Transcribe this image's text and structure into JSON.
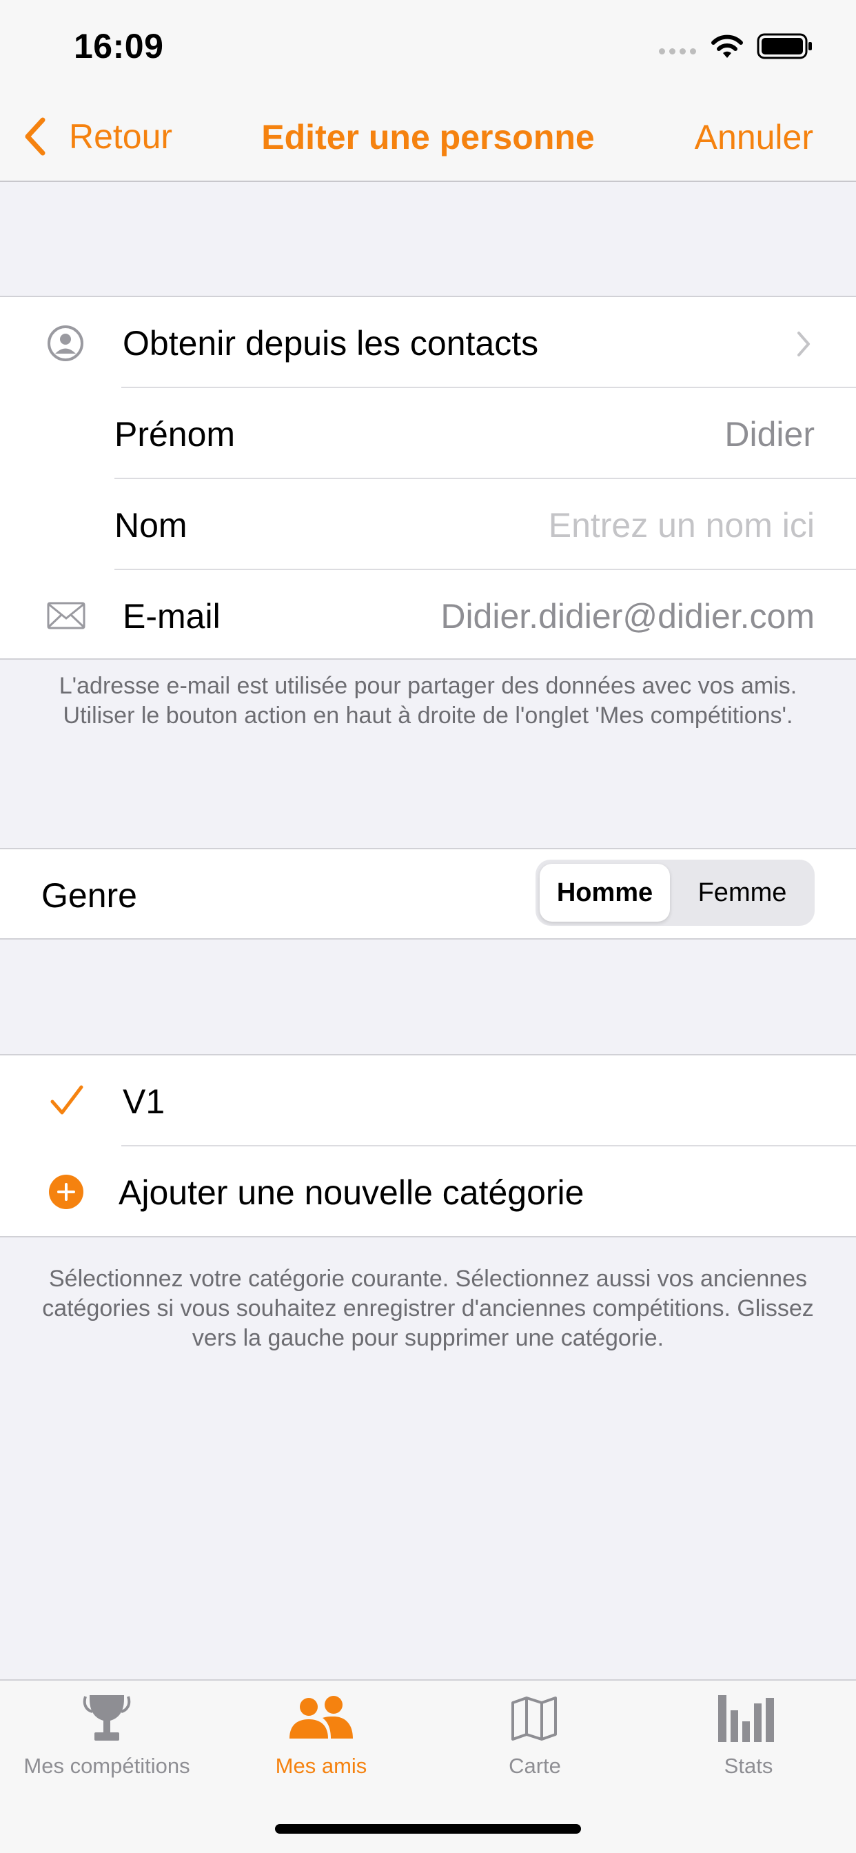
{
  "status_bar": {
    "time": "16:09"
  },
  "nav": {
    "back_label": "Retour",
    "title": "Editer une personne",
    "cancel_label": "Annuler"
  },
  "contact_section": {
    "import_label": "Obtenir depuis les contacts",
    "first_name": {
      "label": "Prénom",
      "value": "Didier"
    },
    "last_name": {
      "label": "Nom",
      "value": "",
      "placeholder": "Entrez un nom ici"
    },
    "email": {
      "label": "E-mail",
      "value": "Didier.didier@didier.com"
    },
    "footer": "L'adresse e-mail est utilisée pour partager des données avec vos amis. Utiliser le bouton action en haut à droite de l'onglet 'Mes compétitions'."
  },
  "gender": {
    "label": "Genre",
    "options": [
      "Homme",
      "Femme"
    ],
    "selected": "Homme"
  },
  "categories": {
    "items": [
      {
        "label": "V1",
        "checked": true
      }
    ],
    "add_label": "Ajouter une nouvelle catégorie",
    "footer": "Sélectionnez votre catégorie courante. Sélectionnez aussi vos anciennes catégories si vous souhaitez enregistrer d'anciennes compétitions. Glissez vers la gauche pour supprimer une catégorie."
  },
  "tab_bar": {
    "tabs": [
      {
        "label": "Mes compétitions",
        "icon": "trophy-icon",
        "active": false
      },
      {
        "label": "Mes amis",
        "icon": "people-icon",
        "active": true
      },
      {
        "label": "Carte",
        "icon": "map-icon",
        "active": false
      },
      {
        "label": "Stats",
        "icon": "bar-chart-icon",
        "active": false
      }
    ]
  },
  "colors": {
    "accent": "#F5820F",
    "background": "#F2F2F7",
    "secondary_text": "#8E8E93",
    "placeholder": "#C4C4C7"
  }
}
